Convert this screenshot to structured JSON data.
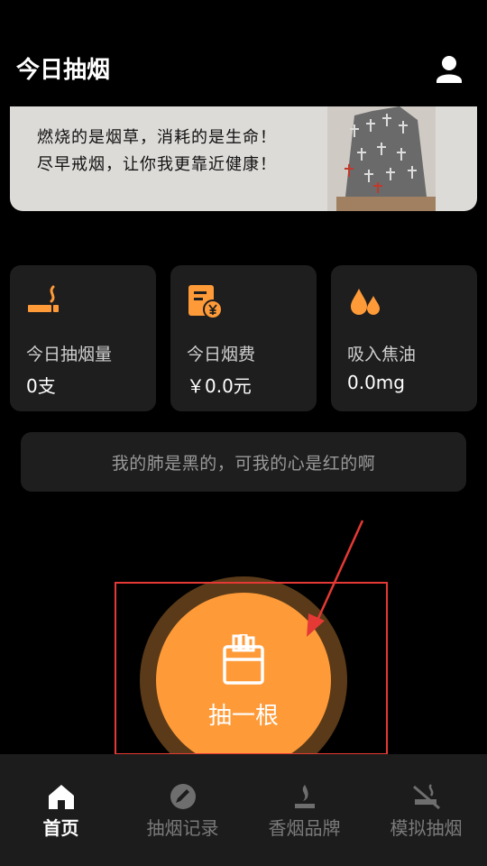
{
  "header": {
    "title": "今日抽烟"
  },
  "banner": {
    "line1": "燃烧的是烟草，消耗的是生命！",
    "line2": "尽早戒烟，让你我更靠近健康！"
  },
  "stats": [
    {
      "label": "今日抽烟量",
      "value": "0支",
      "icon": "cigarette-icon"
    },
    {
      "label": "今日烟费",
      "value": "￥0.0元",
      "icon": "receipt-yen-icon"
    },
    {
      "label": "吸入焦油",
      "value": "0.0mg",
      "icon": "drops-icon"
    }
  ],
  "quote": "我的肺是黑的，可我的心是红的啊",
  "smoke_button": {
    "label": "抽一根",
    "icon": "cigarette-pack-icon"
  },
  "nav": [
    {
      "label": "首页",
      "icon": "home-icon",
      "active": true
    },
    {
      "label": "抽烟记录",
      "icon": "pencil-circle-icon",
      "active": false
    },
    {
      "label": "香烟品牌",
      "icon": "flame-icon",
      "active": false
    },
    {
      "label": "模拟抽烟",
      "icon": "no-smoking-icon",
      "active": false
    }
  ],
  "colors": {
    "accent": "#ff9a38",
    "background": "#000000",
    "card": "#1e1e1e",
    "highlight": "#e53935"
  }
}
